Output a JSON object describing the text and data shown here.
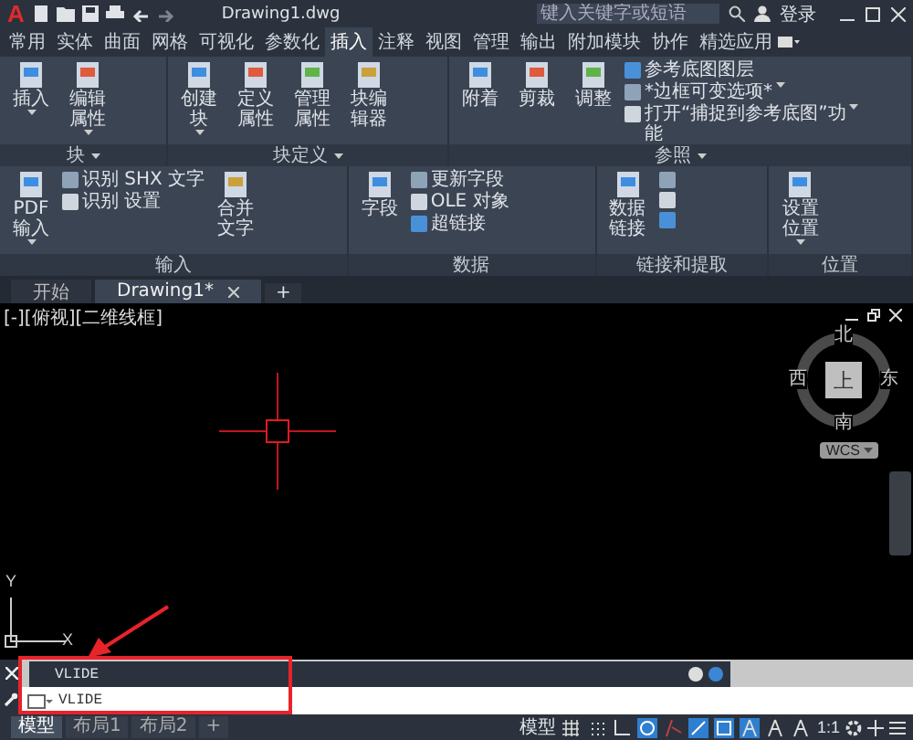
{
  "title_bar": {
    "logo": "A",
    "file_name": "Drawing1.dwg",
    "search": {
      "placeholder": "键入关键字或短语"
    },
    "sign_in": "登录"
  },
  "ribbon_tabs": [
    {
      "label": "常用",
      "selected": false
    },
    {
      "label": "实体",
      "selected": false
    },
    {
      "label": "曲面",
      "selected": false
    },
    {
      "label": "网格",
      "selected": false
    },
    {
      "label": "可视化",
      "selected": false
    },
    {
      "label": "参数化",
      "selected": false
    },
    {
      "label": "插入",
      "selected": true
    },
    {
      "label": "注释",
      "selected": false
    },
    {
      "label": "视图",
      "selected": false
    },
    {
      "label": "管理",
      "selected": false
    },
    {
      "label": "输出",
      "selected": false
    },
    {
      "label": "附加模块",
      "selected": false
    },
    {
      "label": "协作",
      "selected": false
    },
    {
      "label": "精选应用",
      "selected": false
    }
  ],
  "ribbon_groups": [
    {
      "label": "块",
      "dropdown": true,
      "buttons": [
        {
          "kind": "large",
          "label": "插入",
          "menu": true
        },
        {
          "kind": "large",
          "label": "编辑属性",
          "menu": true
        }
      ]
    },
    {
      "label": "块定义",
      "dropdown": true,
      "buttons": [
        {
          "kind": "large",
          "label": "创建块",
          "menu": true
        },
        {
          "kind": "large",
          "label": "定义属性",
          "menu": false
        },
        {
          "kind": "large",
          "label": "管理属性",
          "menu": false
        },
        {
          "kind": "large",
          "label": "块编辑器",
          "menu": false
        }
      ]
    },
    {
      "label": "参照",
      "dropdown": true,
      "buttons": [
        {
          "kind": "large",
          "label": "附着",
          "menu": false
        },
        {
          "kind": "large",
          "label": "剪裁",
          "menu": false
        },
        {
          "kind": "large",
          "label": "调整",
          "menu": false
        },
        {
          "kind": "small",
          "label": "参考底图图层",
          "menu": false
        },
        {
          "kind": "small",
          "label": "*边框可变选项*",
          "menu": true
        },
        {
          "kind": "small",
          "label": "打开“捕捉到参考底图”功能",
          "menu": true
        }
      ]
    },
    {
      "label": "输入",
      "dropdown": false,
      "buttons": [
        {
          "kind": "large",
          "label": "PDF 输入",
          "menu": true
        },
        {
          "kind": "small",
          "label": "识别 SHX 文字",
          "menu": false
        },
        {
          "kind": "small",
          "label": "识别 设置",
          "menu": false
        },
        {
          "kind": "large",
          "label": "合并文字",
          "menu": false
        }
      ]
    },
    {
      "label": "数据",
      "dropdown": false,
      "buttons": [
        {
          "kind": "large",
          "label": "字段",
          "menu": false
        },
        {
          "kind": "small",
          "label": "更新字段",
          "menu": false
        },
        {
          "kind": "small",
          "label": "OLE 对象",
          "menu": false
        },
        {
          "kind": "small",
          "label": "超链接",
          "menu": false
        }
      ]
    },
    {
      "label": "链接和提取",
      "dropdown": false,
      "buttons": [
        {
          "kind": "large",
          "label": "数据链接",
          "menu": false
        },
        {
          "kind": "icon"
        },
        {
          "kind": "icon"
        },
        {
          "kind": "icon"
        }
      ]
    },
    {
      "label": "位置",
      "dropdown": false,
      "buttons": [
        {
          "kind": "large",
          "label": "设置位置",
          "menu": true
        }
      ]
    }
  ],
  "document_tabs": [
    {
      "label": "开始",
      "selected": false,
      "closable": false
    },
    {
      "label": "Drawing1*",
      "selected": true,
      "closable": true
    }
  ],
  "new_tab": "+",
  "viewport": {
    "label": "[-][俯视][二维线框]",
    "viewcube": {
      "north": "北",
      "south": "南",
      "east": "东",
      "west": "西",
      "face": "上",
      "ucs_menu": "WCS"
    },
    "ucs": {
      "x": "X",
      "y": "Y"
    }
  },
  "command_line": {
    "history": "VLIDE",
    "input": "VLIDE"
  },
  "layout_tabs": [
    {
      "label": "模型",
      "selected": true
    },
    {
      "label": "布局1",
      "selected": false
    },
    {
      "label": "布局2",
      "selected": false
    }
  ],
  "new_layout": "+",
  "status_bar": {
    "model": "模型",
    "scale": "1:1",
    "toggles": [
      {
        "kind": "grid",
        "on": false
      },
      {
        "kind": "snap",
        "on": false
      },
      {
        "kind": "ortho",
        "on": false
      },
      {
        "kind": "polar",
        "on": true
      },
      {
        "kind": "isodraft",
        "on": false
      },
      {
        "kind": "track",
        "on": true
      },
      {
        "kind": "osnap",
        "on": true
      },
      {
        "kind": "annotation",
        "on": true
      },
      {
        "kind": "annotation",
        "on": false
      },
      {
        "kind": "annotation",
        "on": false
      }
    ]
  }
}
